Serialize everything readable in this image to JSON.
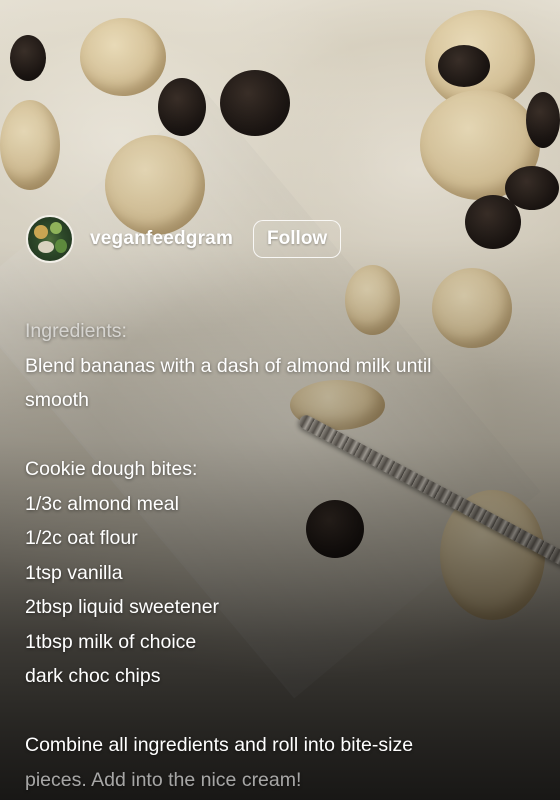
{
  "post": {
    "username": "veganfeedgram",
    "follow_label": "Follow",
    "avatar_icon": "profile-avatar-icon"
  },
  "caption": {
    "heading": "Ingredients:",
    "intro_line_1": "Blend bananas with a dash of almond milk until",
    "intro_line_2": "smooth",
    "dough_heading": "Cookie dough bites:",
    "items": [
      "1/3c almond meal",
      "1/2c oat flour",
      "1tsp vanilla",
      "2tbsp liquid sweetener",
      "1tbsp milk of choice",
      "dark choc chips"
    ],
    "instruction_line_1": "Combine all ingredients and roll into bite-size",
    "instruction_line_2": "pieces. Add into the nice cream!"
  },
  "colors": {
    "text": "#ffffff",
    "muted_text": "rgba(255,255,255,0.62)"
  }
}
